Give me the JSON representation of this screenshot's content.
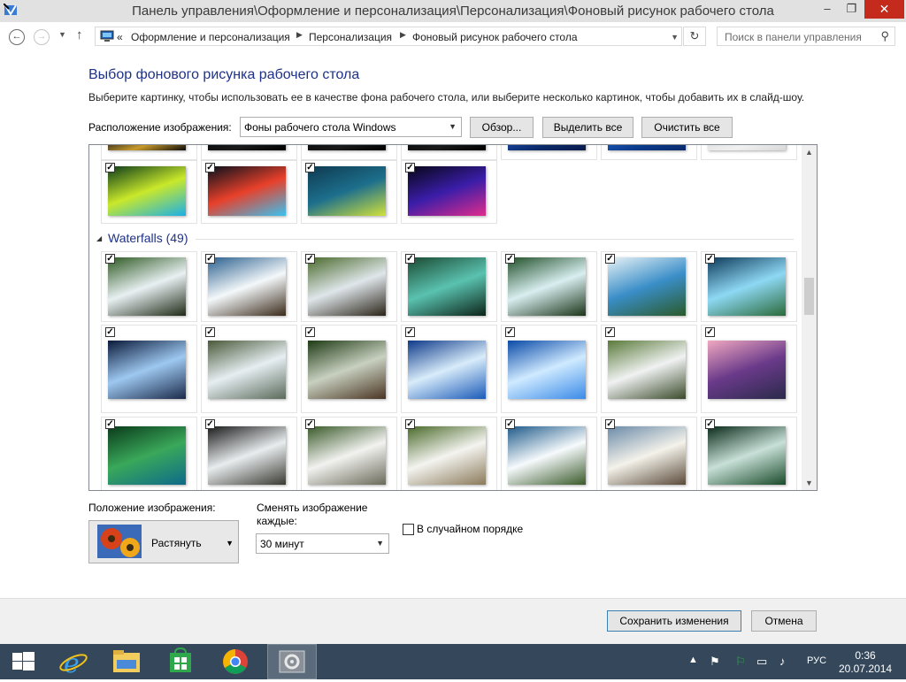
{
  "window": {
    "title": "Панель управления\\Оформление и персонализация\\Персонализация\\Фоновый рисунок рабочего стола",
    "minimize": "–",
    "maximize": "❐",
    "close": "✕"
  },
  "address": {
    "overflow": "«",
    "crumbs": [
      "Оформление и персонализация",
      "Персонализация",
      "Фоновый рисунок рабочего стола"
    ]
  },
  "search": {
    "placeholder": "Поиск в панели управления"
  },
  "main": {
    "heading": "Выбор фонового рисунка рабочего стола",
    "description": "Выберите картинку, чтобы использовать ее в качестве фона рабочего стола, или выберите несколько картинок, чтобы добавить их в слайд-шоу.",
    "location_label": "Расположение изображения:",
    "location_value": "Фоны рабочего стола Windows",
    "browse_label": "Обзор...",
    "select_all_label": "Выделить все",
    "clear_all_label": "Очистить все"
  },
  "gallery": {
    "group_title": "Waterfalls (49)",
    "checkmark": "✓",
    "abstract_items": [
      {
        "colors": [
          "#0b3a1a",
          "#c9e82a",
          "#1ab0e8"
        ]
      },
      {
        "colors": [
          "#06101c",
          "#e8402a",
          "#3ac2f0"
        ]
      },
      {
        "colors": [
          "#0e3950",
          "#1d6f8c",
          "#d2e23a"
        ]
      },
      {
        "colors": [
          "#070716",
          "#3a1da8",
          "#e02c8c"
        ]
      }
    ],
    "waterfall_rows": [
      [
        {
          "colors": [
            "#2f5a24",
            "#e8f0f2",
            "#1e2a16"
          ]
        },
        {
          "colors": [
            "#2a5f8e",
            "#f4f8fa",
            "#3a2a1a"
          ]
        },
        {
          "colors": [
            "#4a6a2c",
            "#dfe6ea",
            "#2a2418"
          ]
        },
        {
          "colors": [
            "#1a4a32",
            "#5ac2b0",
            "#0c2418"
          ]
        },
        {
          "colors": [
            "#22502a",
            "#d8eef0",
            "#1a3418"
          ]
        },
        {
          "colors": [
            "#e8f2f6",
            "#3a8ec8",
            "#2a5a2a"
          ]
        },
        {
          "colors": [
            "#0e3a5a",
            "#8ed8f4",
            "#2a6a3a"
          ]
        }
      ],
      [
        {
          "colors": [
            "#0a1a3a",
            "#9ec8f0",
            "#1a2a4a"
          ]
        },
        {
          "colors": [
            "#4a5a3a",
            "#e6eef2",
            "#5a6a5a"
          ]
        },
        {
          "colors": [
            "#1e3a14",
            "#c8d0c0",
            "#4a3422"
          ]
        },
        {
          "colors": [
            "#0e3a8a",
            "#d8ecfa",
            "#1a5ab8"
          ]
        },
        {
          "colors": [
            "#0a4aa8",
            "#cfeaff",
            "#3a8ae8"
          ]
        },
        {
          "colors": [
            "#5a7a3a",
            "#f0f2f2",
            "#3a4a2a"
          ]
        },
        {
          "colors": [
            "#f0a8c0",
            "#6a3a8a",
            "#2a2a4a"
          ]
        }
      ],
      [
        {
          "colors": [
            "#0a3a1a",
            "#3aa85a",
            "#0e6a8a"
          ]
        },
        {
          "colors": [
            "#1a1a1a",
            "#e8ecee",
            "#3a3a32"
          ]
        },
        {
          "colors": [
            "#3a5a2a",
            "#f2f2f0",
            "#6a6a5a"
          ]
        },
        {
          "colors": [
            "#4a6a2a",
            "#f4f4f0",
            "#8a7a5a"
          ]
        },
        {
          "colors": [
            "#1e5a8a",
            "#f6fafc",
            "#3a5a2a"
          ]
        },
        {
          "colors": [
            "#6a8aa8",
            "#f4f2ea",
            "#5a4a3a"
          ]
        },
        {
          "colors": [
            "#0a2a1a",
            "#c8e0d8",
            "#1a4a2a"
          ]
        }
      ]
    ]
  },
  "options": {
    "position_label": "Положение изображения:",
    "position_value": "Растянуть",
    "interval_label": "Сменять изображение каждые:",
    "interval_value": "30 минут",
    "shuffle_label": "В случайном порядке"
  },
  "footer": {
    "save_label": "Сохранить изменения",
    "cancel_label": "Отмена"
  },
  "taskbar": {
    "lang": "РУС",
    "time": "0:36",
    "date": "20.07.2014"
  }
}
